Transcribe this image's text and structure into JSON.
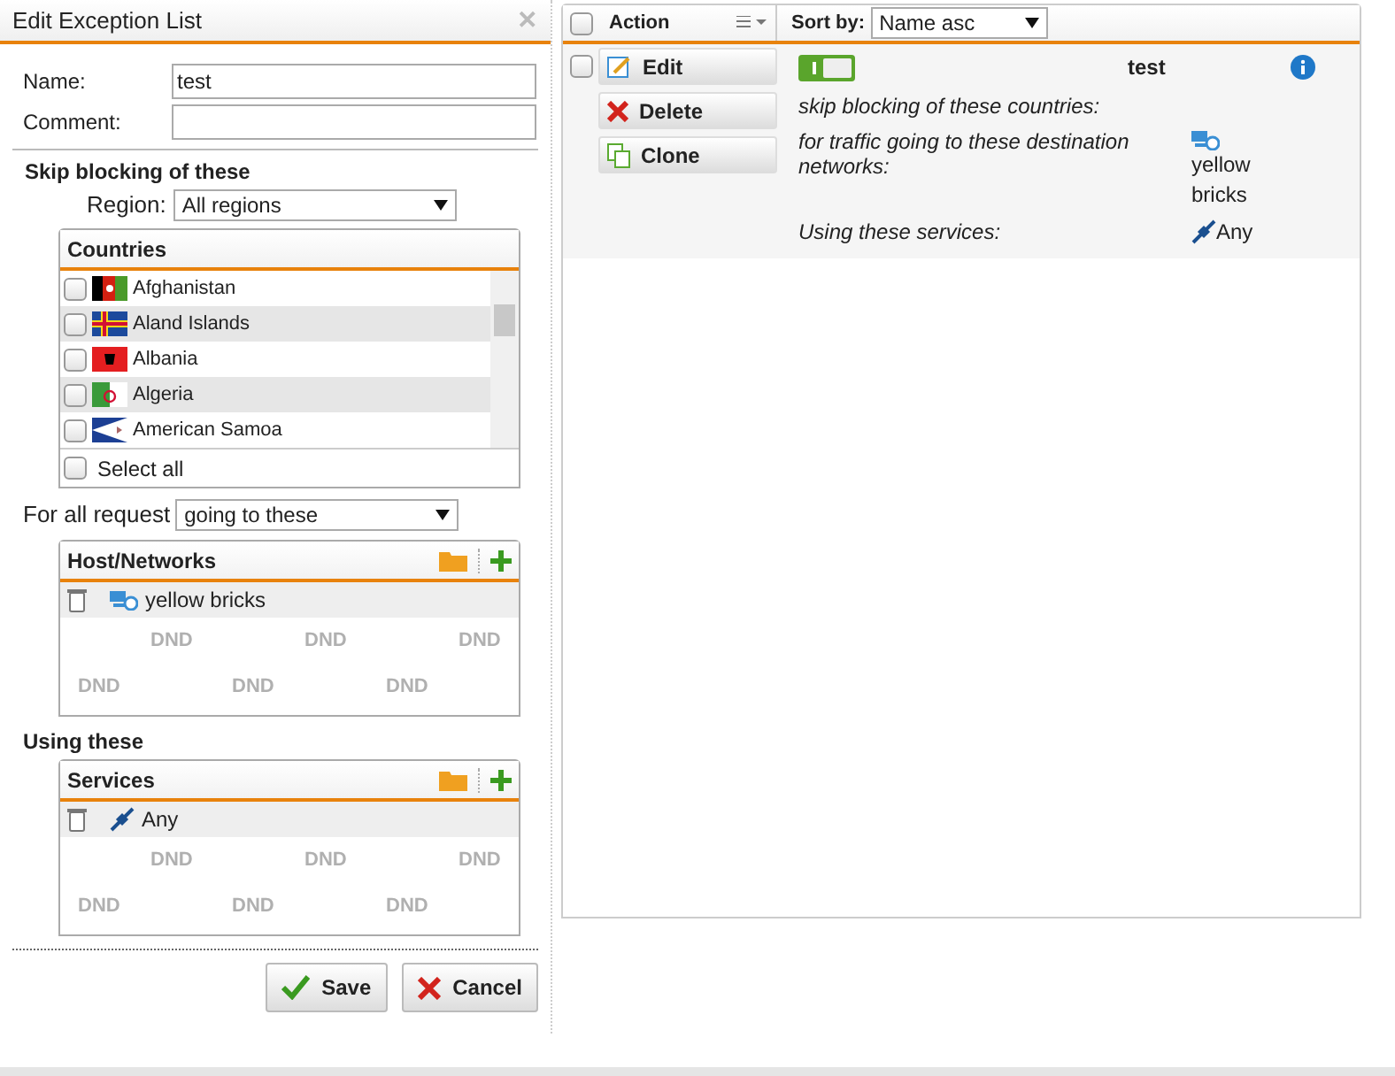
{
  "dialog": {
    "title": "Edit Exception List",
    "close": "✕",
    "name": {
      "label": "Name:",
      "value": "test"
    },
    "comment": {
      "label": "Comment:"
    },
    "skip_heading": "Skip blocking of these",
    "region": {
      "label": "Region:",
      "value": "All regions"
    },
    "countries": {
      "title": "Countries",
      "items": [
        {
          "name": "Afghanistan",
          "checked": false,
          "kind": "af"
        },
        {
          "name": "Aland Islands",
          "checked": false,
          "kind": "ax"
        },
        {
          "name": "Albania",
          "checked": false,
          "kind": "al"
        },
        {
          "name": "Algeria",
          "checked": false,
          "kind": "dz"
        },
        {
          "name": "American Samoa",
          "checked": false,
          "kind": "as"
        }
      ],
      "select_all": {
        "label": "Select all",
        "checked": false
      }
    },
    "request": {
      "label": "For all request",
      "value": "going to these"
    },
    "hosts": {
      "title": "Host/Networks",
      "items": [
        {
          "name": "yellow bricks",
          "kind": "network"
        }
      ],
      "dnd": [
        "DND",
        "DND",
        "DND",
        "DND",
        "DND",
        "DND"
      ]
    },
    "using_heading": "Using these",
    "services": {
      "title": "Services",
      "items": [
        {
          "name": "Any",
          "kind": "service"
        }
      ],
      "dnd": [
        "DND",
        "DND",
        "DND",
        "DND",
        "DND",
        "DND"
      ]
    },
    "buttons": [
      {
        "label": "Save",
        "kind": "save"
      },
      {
        "label": "Cancel",
        "kind": "cancel"
      }
    ]
  },
  "list": {
    "header": {
      "checked": false,
      "action": "Action",
      "sort_label": "Sort by:",
      "sort_value": "Name asc"
    },
    "rows": [
      {
        "checked": false,
        "actions": [
          {
            "label": "Edit",
            "kind": "edit"
          },
          {
            "label": "Delete",
            "kind": "delete"
          },
          {
            "label": "Clone",
            "kind": "clone"
          }
        ],
        "on": true,
        "name": "test",
        "countries_label": "skip blocking of these countries:",
        "networks_label": "for traffic going to these destination networks:",
        "network": "yellow bricks",
        "services_label": "Using these services:",
        "service": "Any"
      }
    ]
  }
}
